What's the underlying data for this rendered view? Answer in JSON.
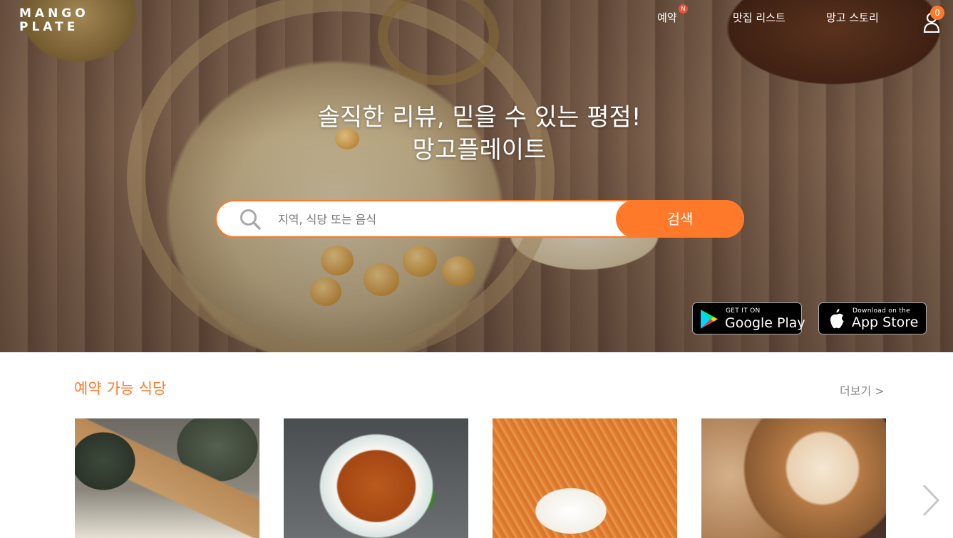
{
  "brand": {
    "logo_line1": "MANGO",
    "logo_line2": "PLATE"
  },
  "nav": {
    "reservation": "예약",
    "reservation_badge": "N",
    "restaurant_list": "맛집 리스트",
    "mango_story": "망고 스토리",
    "user_count": "0"
  },
  "hero": {
    "headline_line1": "솔직한 리뷰, 믿을 수 있는 평점!",
    "headline_line2": "망고플레이트"
  },
  "search": {
    "placeholder": "지역, 식당 또는 음식",
    "button_label": "검색"
  },
  "stores": {
    "google_small": "GET IT ON",
    "google_big": "Google Play",
    "apple_small": "Download on the",
    "apple_big": "App Store"
  },
  "section": {
    "title": "예약 가능 식당",
    "more_label": "더보기 >"
  },
  "colors": {
    "accent": "#ff792a",
    "badge": "#e8513a"
  }
}
